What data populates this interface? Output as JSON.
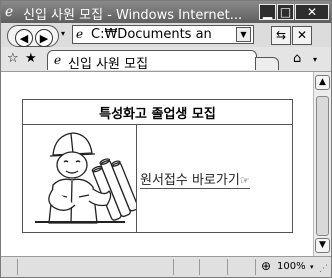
{
  "window": {
    "title": "신입 사원 모집 - Windows Internet...",
    "minimize_symbol": "▁",
    "maximize_symbol": "□",
    "close_symbol": "✕"
  },
  "toolbar": {
    "back_symbol": "◀",
    "forward_symbol": "▶",
    "dropdown_symbol": "▾",
    "address": "C:₩Documents an",
    "address_dropdown_symbol": "▼",
    "refresh_symbol": "⇆",
    "stop_symbol": "✕"
  },
  "favorites": {
    "star_symbol": "☆",
    "add_symbol": "★",
    "tab_title": "신입 사원 모집",
    "home_dropdown_symbol": "▾"
  },
  "content": {
    "heading": "특성화고 졸업생 모집",
    "apply_link": "원서접수 바로가기"
  },
  "scrollbar": {
    "up_symbol": "▲",
    "down_symbol": "▼"
  },
  "statusbar": {
    "zoom": "100%",
    "zoom_dropdown_symbol": "▾",
    "grip_symbol": "⋰"
  },
  "icons": {
    "page": "ie-page-icon",
    "home": "home-icon",
    "hand": "pointing-hand-icon",
    "zoom": "magnifier-icon",
    "illustration": "worker-with-rolled-plans"
  }
}
